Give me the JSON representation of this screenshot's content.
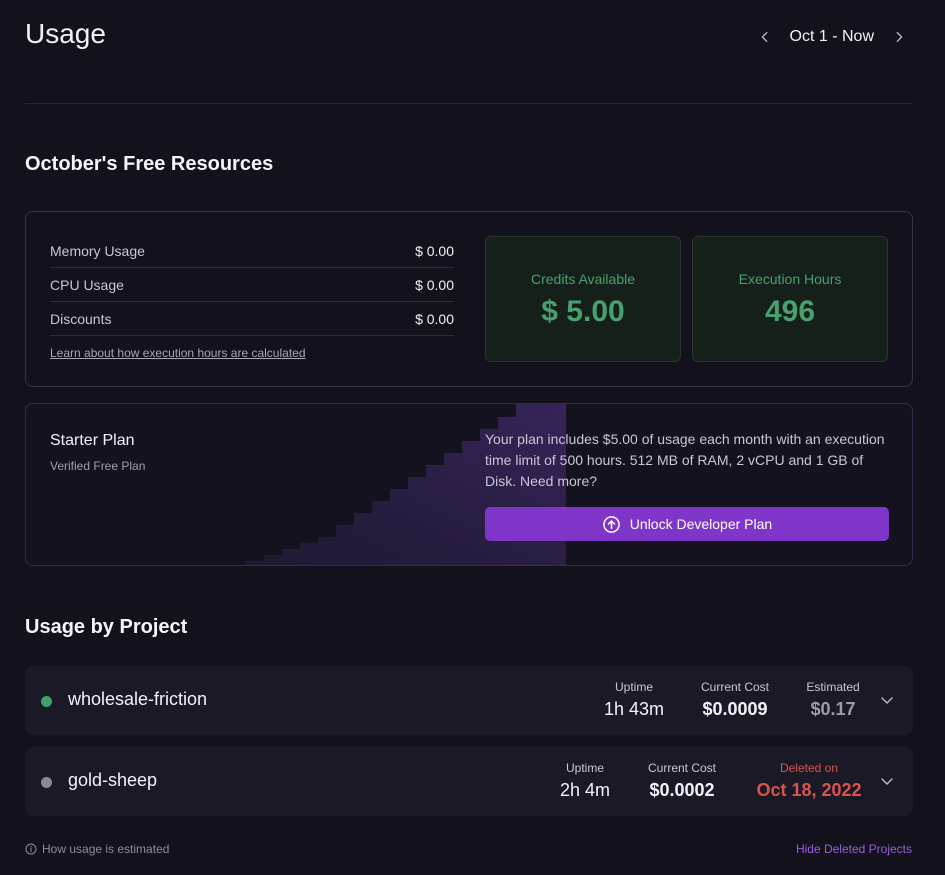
{
  "header": {
    "title": "Usage",
    "date_range": "Oct 1 - Now"
  },
  "free_resources": {
    "title": "October's Free Resources",
    "rows": [
      {
        "label": "Memory Usage",
        "value": "$ 0.00"
      },
      {
        "label": "CPU Usage",
        "value": "$ 0.00"
      },
      {
        "label": "Discounts",
        "value": "$ 0.00"
      }
    ],
    "link": "Learn about how execution hours are calculated",
    "credits": {
      "label": "Credits Available",
      "value": "$ 5.00"
    },
    "hours": {
      "label": "Execution Hours",
      "value": "496"
    }
  },
  "plan": {
    "name": "Starter Plan",
    "subtitle": "Verified Free Plan",
    "description": "Your plan includes $5.00 of usage each month with an execution time limit of 500 hours. 512 MB of RAM, 2 vCPU and 1 GB of Disk. Need more?",
    "button": "Unlock Developer Plan"
  },
  "projects": {
    "title": "Usage by Project",
    "items": [
      {
        "name": "wholesale-friction",
        "status_color": "#3fa06a",
        "uptime_label": "Uptime",
        "uptime": "1h 43m",
        "cost_label": "Current Cost",
        "cost": "$0.0009",
        "third_label": "Estimated",
        "third_value": "$0.17"
      },
      {
        "name": "gold-sheep",
        "status_color": "#8a8796",
        "uptime_label": "Uptime",
        "uptime": "2h 4m",
        "cost_label": "Current Cost",
        "cost": "$0.0002",
        "third_label": "Deleted on",
        "third_value": "Oct 18, 2022"
      }
    ]
  },
  "footer": {
    "estimate_link": "How usage is estimated",
    "hide_deleted": "Hide Deleted Projects"
  },
  "colors": {
    "background": "#13111c",
    "accent_purple": "#7f36c8",
    "green": "#47a06d",
    "deleted_red": "#d8544f",
    "link_purple": "#9b5ee0"
  }
}
